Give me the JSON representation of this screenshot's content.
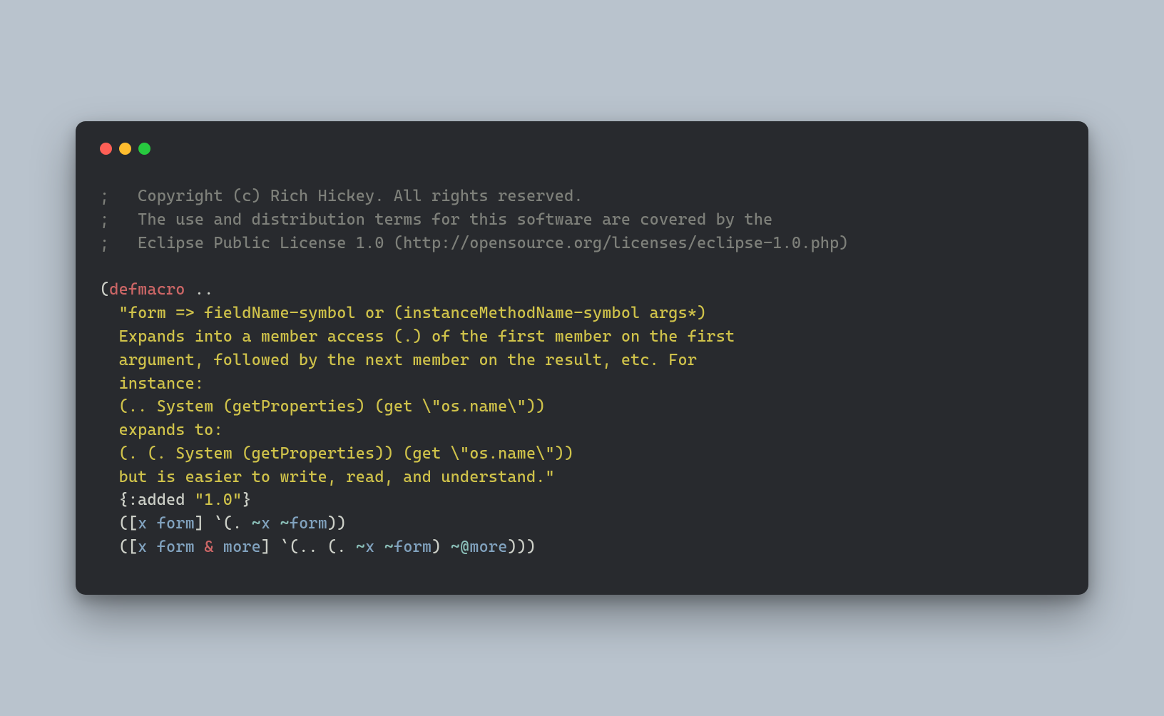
{
  "comments": {
    "line1": ";   Copyright (c) Rich Hickey. All rights reserved.",
    "line2": ";   The use and distribution terms for this software are covered by the",
    "line3": ";   Eclipse Public License 1.0 (http://opensource.org/licenses/eclipse-1.0.php)"
  },
  "code": {
    "open_paren": "(",
    "defmacro": "defmacro",
    "macro_name": " ..",
    "doc1": "  \"form => fieldName-symbol or (instanceMethodName-symbol args*)",
    "doc2": "  Expands into a member access (.) of the first member on the first",
    "doc3": "  argument, followed by the next member on the result, etc. For",
    "doc4": "  instance:",
    "doc5": "  (.. System (getProperties) (get \\\"os.name\\\"))",
    "doc6": "  expands to:",
    "doc7": "  (. (. System (getProperties)) (get \\\"os.name\\\"))",
    "doc8": "  but is easier to write, read, and understand.\"",
    "meta_open": "  {",
    "meta_key": ":added",
    "meta_space": " ",
    "meta_val": "\"1.0\"",
    "meta_close": "}",
    "b1_open": "  ([",
    "b1_x": "x",
    "b1_sp1": " ",
    "b1_form": "form",
    "b1_close_args": "] `(. ",
    "b1_tilde1": "~",
    "b1_x2": "x",
    "b1_sp2": " ",
    "b1_tilde2": "~",
    "b1_form2": "form",
    "b1_end": "))",
    "b2_open": "  ([",
    "b2_x": "x",
    "b2_sp1": " ",
    "b2_form": "form",
    "b2_sp2": " ",
    "b2_amp": "&",
    "b2_sp3": " ",
    "b2_more": "more",
    "b2_close_args": "] `(.. (. ",
    "b2_tilde1": "~",
    "b2_x2": "x",
    "b2_sp4": " ",
    "b2_tilde2": "~",
    "b2_form2": "form",
    "b2_mid": ") ",
    "b2_spliceop": "~@",
    "b2_more2": "more",
    "b2_end": ")))"
  }
}
